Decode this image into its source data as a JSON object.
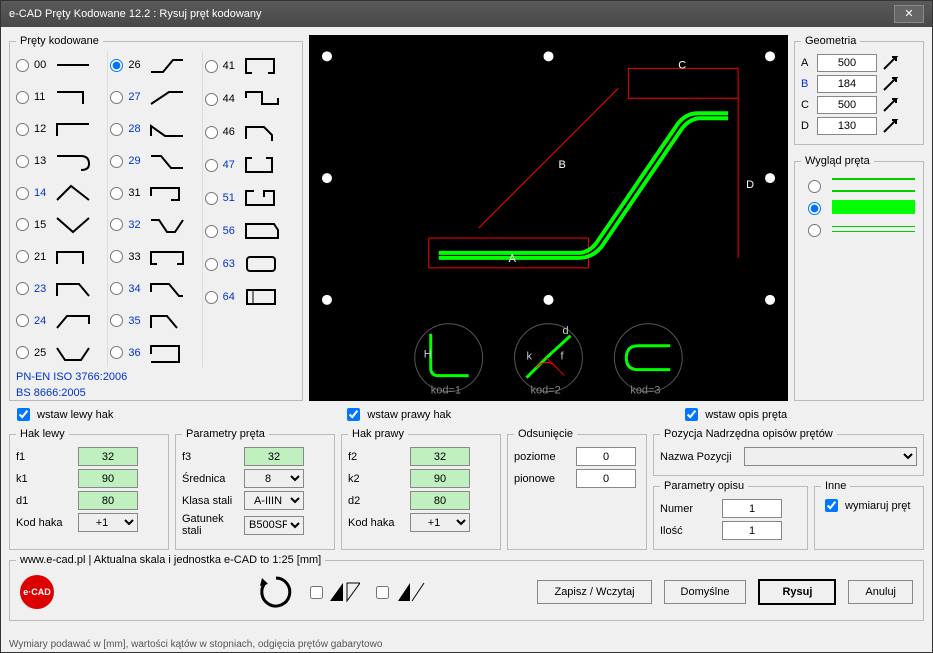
{
  "title": "e-CAD Pręty Kodowane 12.2 : Rysuj pręt kodowany",
  "shapes_box_legend": "Pręty kodowane",
  "shapes_col1": [
    "00",
    "11",
    "12",
    "13",
    "14",
    "15",
    "21",
    "23",
    "24",
    "25"
  ],
  "shapes_col2": [
    "26",
    "27",
    "28",
    "29",
    "31",
    "32",
    "33",
    "34",
    "35",
    "36"
  ],
  "shapes_col3": [
    "41",
    "44",
    "46",
    "47",
    "51",
    "56",
    "63",
    "64"
  ],
  "selected_shape": "26",
  "blue_codes": [
    "14",
    "23",
    "24",
    "27",
    "28",
    "29",
    "32",
    "34",
    "35",
    "36",
    "47",
    "51",
    "56",
    "63",
    "64"
  ],
  "iso_line1": "PN-EN ISO 3766:2006",
  "iso_line2": "BS 8666:2005",
  "geom_legend": "Geometria",
  "geom": [
    {
      "lbl": "A",
      "val": "500",
      "blue": false
    },
    {
      "lbl": "B",
      "val": "184",
      "blue": true
    },
    {
      "lbl": "C",
      "val": "500",
      "blue": false
    },
    {
      "lbl": "D",
      "val": "130",
      "blue": false
    }
  ],
  "appearance_legend": "Wygląd pręta",
  "check_left": "wstaw lewy hak",
  "check_right": "wstaw prawy hak",
  "check_desc": "wstaw opis pręta",
  "hak_lewy_legend": "Hak lewy",
  "hak_prawy_legend": "Hak prawy",
  "params_legend": "Parametry pręta",
  "offset_legend": "Odsunięcie",
  "pos_legend": "Pozycja Nadrzędna opisów prętów",
  "desc_legend": "Parametry opisu",
  "inne_legend": "Inne",
  "labels": {
    "f1": "f1",
    "k1": "k1",
    "d1": "d1",
    "kodhaka": "Kod haka",
    "f2": "f2",
    "k2": "k2",
    "d2": "d2",
    "f3": "f3",
    "srednica": "Średnica",
    "klasa": "Klasa stali",
    "gatunek": "Gatunek stali",
    "poziome": "poziome",
    "pionowe": "pionowe",
    "nazwa": "Nazwa Pozycji",
    "numer": "Numer",
    "ilosc": "Ilość",
    "wymiaruj": "wymiaruj pręt"
  },
  "values": {
    "f1": "32",
    "k1": "90",
    "d1": "80",
    "kodhaka1": "+1",
    "f2": "32",
    "k2": "90",
    "d2": "80",
    "kodhaka2": "+1",
    "f3": "32",
    "srednica": "8",
    "klasa": "A-IIIN",
    "gatunek": "B500SP",
    "poziome": "0",
    "pionowe": "0",
    "numer": "1",
    "ilosc": "1"
  },
  "scale_text": "www.e-cad.pl | Aktualna skala i jednostka e-CAD to 1:25 [mm]",
  "btn_save": "Zapisz / Wczytaj",
  "btn_default": "Domyślne",
  "btn_draw": "Rysuj",
  "btn_cancel": "Anuluj",
  "footer": "Wymiary podawać w [mm], wartości kątów w stopniach, odgięcia prętów gabarytowo",
  "preview_labels": {
    "A": "A",
    "B": "B",
    "C": "C",
    "D": "D",
    "kod1": "kod=1",
    "kod2": "kod=2",
    "kod3": "kod=3",
    "H": "H",
    "d": "d",
    "k": "k",
    "f": "f"
  }
}
